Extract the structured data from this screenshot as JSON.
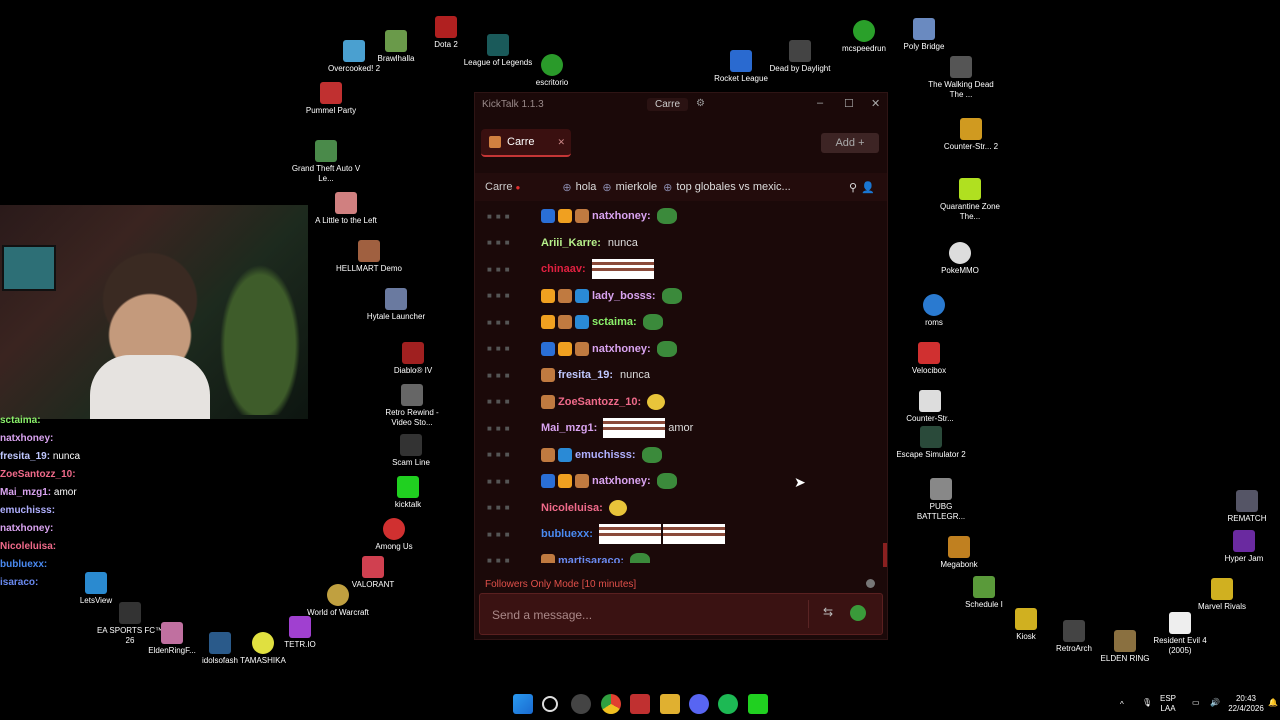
{
  "desktop_icons": [
    {
      "label": "Brawlhalla"
    },
    {
      "label": "Dota 2"
    },
    {
      "label": "Overcooked! 2"
    },
    {
      "label": "League of Legends"
    },
    {
      "label": "escritorio"
    },
    {
      "label": "Rocket League"
    },
    {
      "label": "Dead by Daylight"
    },
    {
      "label": "mcspeedrun"
    },
    {
      "label": "Poly Bridge"
    },
    {
      "label": "Pummel Party"
    },
    {
      "label": "The Walking Dead The ..."
    },
    {
      "label": "Counter-Str... 2"
    },
    {
      "label": "Grand Theft Auto V Le..."
    },
    {
      "label": "Quarantine Zone The..."
    },
    {
      "label": "A Little to the Left"
    },
    {
      "label": "PokeMMO"
    },
    {
      "label": "HELLMART Demo"
    },
    {
      "label": "Hytale Launcher"
    },
    {
      "label": "roms"
    },
    {
      "label": "Diablo® IV"
    },
    {
      "label": "Velocibox"
    },
    {
      "label": "Retro Rewind - Video Sto..."
    },
    {
      "label": "Counter-Str..."
    },
    {
      "label": "Scam Line"
    },
    {
      "label": "Escape Simulator 2"
    },
    {
      "label": "kicktalk"
    },
    {
      "label": "PUBG BATTLEGR..."
    },
    {
      "label": "REMATCH"
    },
    {
      "label": "Among Us"
    },
    {
      "label": "Megabonk"
    },
    {
      "label": "Hyper Jam"
    },
    {
      "label": "VALORANT"
    },
    {
      "label": "LetsView"
    },
    {
      "label": "World of Warcraft"
    },
    {
      "label": "Schedule I"
    },
    {
      "label": "Marvel Rivals"
    },
    {
      "label": "EA SPORTS FC™ 26"
    },
    {
      "label": "EldenRingF..."
    },
    {
      "label": "idolsofash"
    },
    {
      "label": "TAMASHIKA"
    },
    {
      "label": "TETR.IO"
    },
    {
      "label": "Kiosk"
    },
    {
      "label": "RetroArch"
    },
    {
      "label": "ELDEN RING"
    },
    {
      "label": "Resident Evil 4 (2005)"
    }
  ],
  "overlay_chat": [
    {
      "user": "sctaima:",
      "text": ""
    },
    {
      "user": "natxhoney:",
      "text": ""
    },
    {
      "user": "fresita_19:",
      "text": "nunca"
    },
    {
      "user": "ZoeSantozz_10:",
      "text": ""
    },
    {
      "user": "Mai_mzg1:",
      "text": "amor"
    },
    {
      "user": "emuchisss:",
      "text": ""
    },
    {
      "user": "natxhoney:",
      "text": ""
    },
    {
      "user": "Nicoleluisa:",
      "text": ""
    },
    {
      "user": "bubluexx:",
      "text": ""
    },
    {
      "user": "isaraco:",
      "text": ""
    }
  ],
  "app": {
    "title": "KickTalk 1.1.3",
    "title_channel": "Carre",
    "tab_label": "Carre",
    "add_label": "Add",
    "channel_name": "Carre",
    "pinned": "hola",
    "pinned2": "mierkole",
    "pinned3": "top globales vs mexic...",
    "followers_mode": "Followers Only Mode [10 minutes]",
    "send_placeholder": "Send a message..."
  },
  "messages": [
    {
      "user": "natxhoney:",
      "color": "#d9a3f0",
      "text": "",
      "badges": [
        "#2a6fd6",
        "#f0a020",
        "#c07a40"
      ],
      "emote": "frog"
    },
    {
      "user": "Ariii_Karre:",
      "color": "#b6f08a",
      "text": "nunca",
      "badges": [],
      "emote": ""
    },
    {
      "user": "chinaav:",
      "color": "#e02040",
      "text": "",
      "badges": [],
      "emote": "bench"
    },
    {
      "user": "lady_bosss:",
      "color": "#d9a3f0",
      "text": "",
      "badges": [
        "#f0a020",
        "#c07a40",
        "#2a8ad6"
      ],
      "emote": "frog"
    },
    {
      "user": "sctaima:",
      "color": "#8af06a",
      "text": "",
      "badges": [
        "#f0a020",
        "#c07a40",
        "#2a8ad6"
      ],
      "emote": "frog"
    },
    {
      "user": "natxhoney:",
      "color": "#d9a3f0",
      "text": "",
      "badges": [
        "#2a6fd6",
        "#f0a020",
        "#c07a40"
      ],
      "emote": "frog"
    },
    {
      "user": "fresita_19:",
      "color": "#c0c8ff",
      "text": "nunca",
      "badges": [
        "#c07a40"
      ],
      "emote": ""
    },
    {
      "user": "ZoeSantozz_10:",
      "color": "#f06a8a",
      "text": "",
      "badges": [
        "#c07a40"
      ],
      "emote": "sun"
    },
    {
      "user": "Mai_mzg1:",
      "color": "#d9a3f0",
      "text": "amor",
      "badges": [],
      "emote": "bench"
    },
    {
      "user": "emuchisss:",
      "color": "#b0b0ff",
      "text": "",
      "badges": [
        "#c07a40",
        "#2a8ad6"
      ],
      "emote": "frog"
    },
    {
      "user": "natxhoney:",
      "color": "#d9a3f0",
      "text": "",
      "badges": [
        "#2a6fd6",
        "#f0a020",
        "#c07a40"
      ],
      "emote": "frog"
    },
    {
      "user": "Nicoleluisa:",
      "color": "#f06a8a",
      "text": "",
      "badges": [],
      "emote": "sun"
    },
    {
      "user": "bubluexx:",
      "color": "#4a8af0",
      "text": "",
      "badges": [],
      "emote": "bench2"
    },
    {
      "user": "martisaraco:",
      "color": "#6a8af0",
      "text": "",
      "badges": [
        "#c07a40"
      ],
      "emote": "frog"
    }
  ],
  "tray": {
    "lang": "ESP",
    "lang2": "LAA",
    "time": "20:43",
    "date": "22/4/2026"
  },
  "colors": {
    "accent": "#c43636",
    "window_bg": "#1b0909",
    "followers_text": "#e0504a"
  }
}
